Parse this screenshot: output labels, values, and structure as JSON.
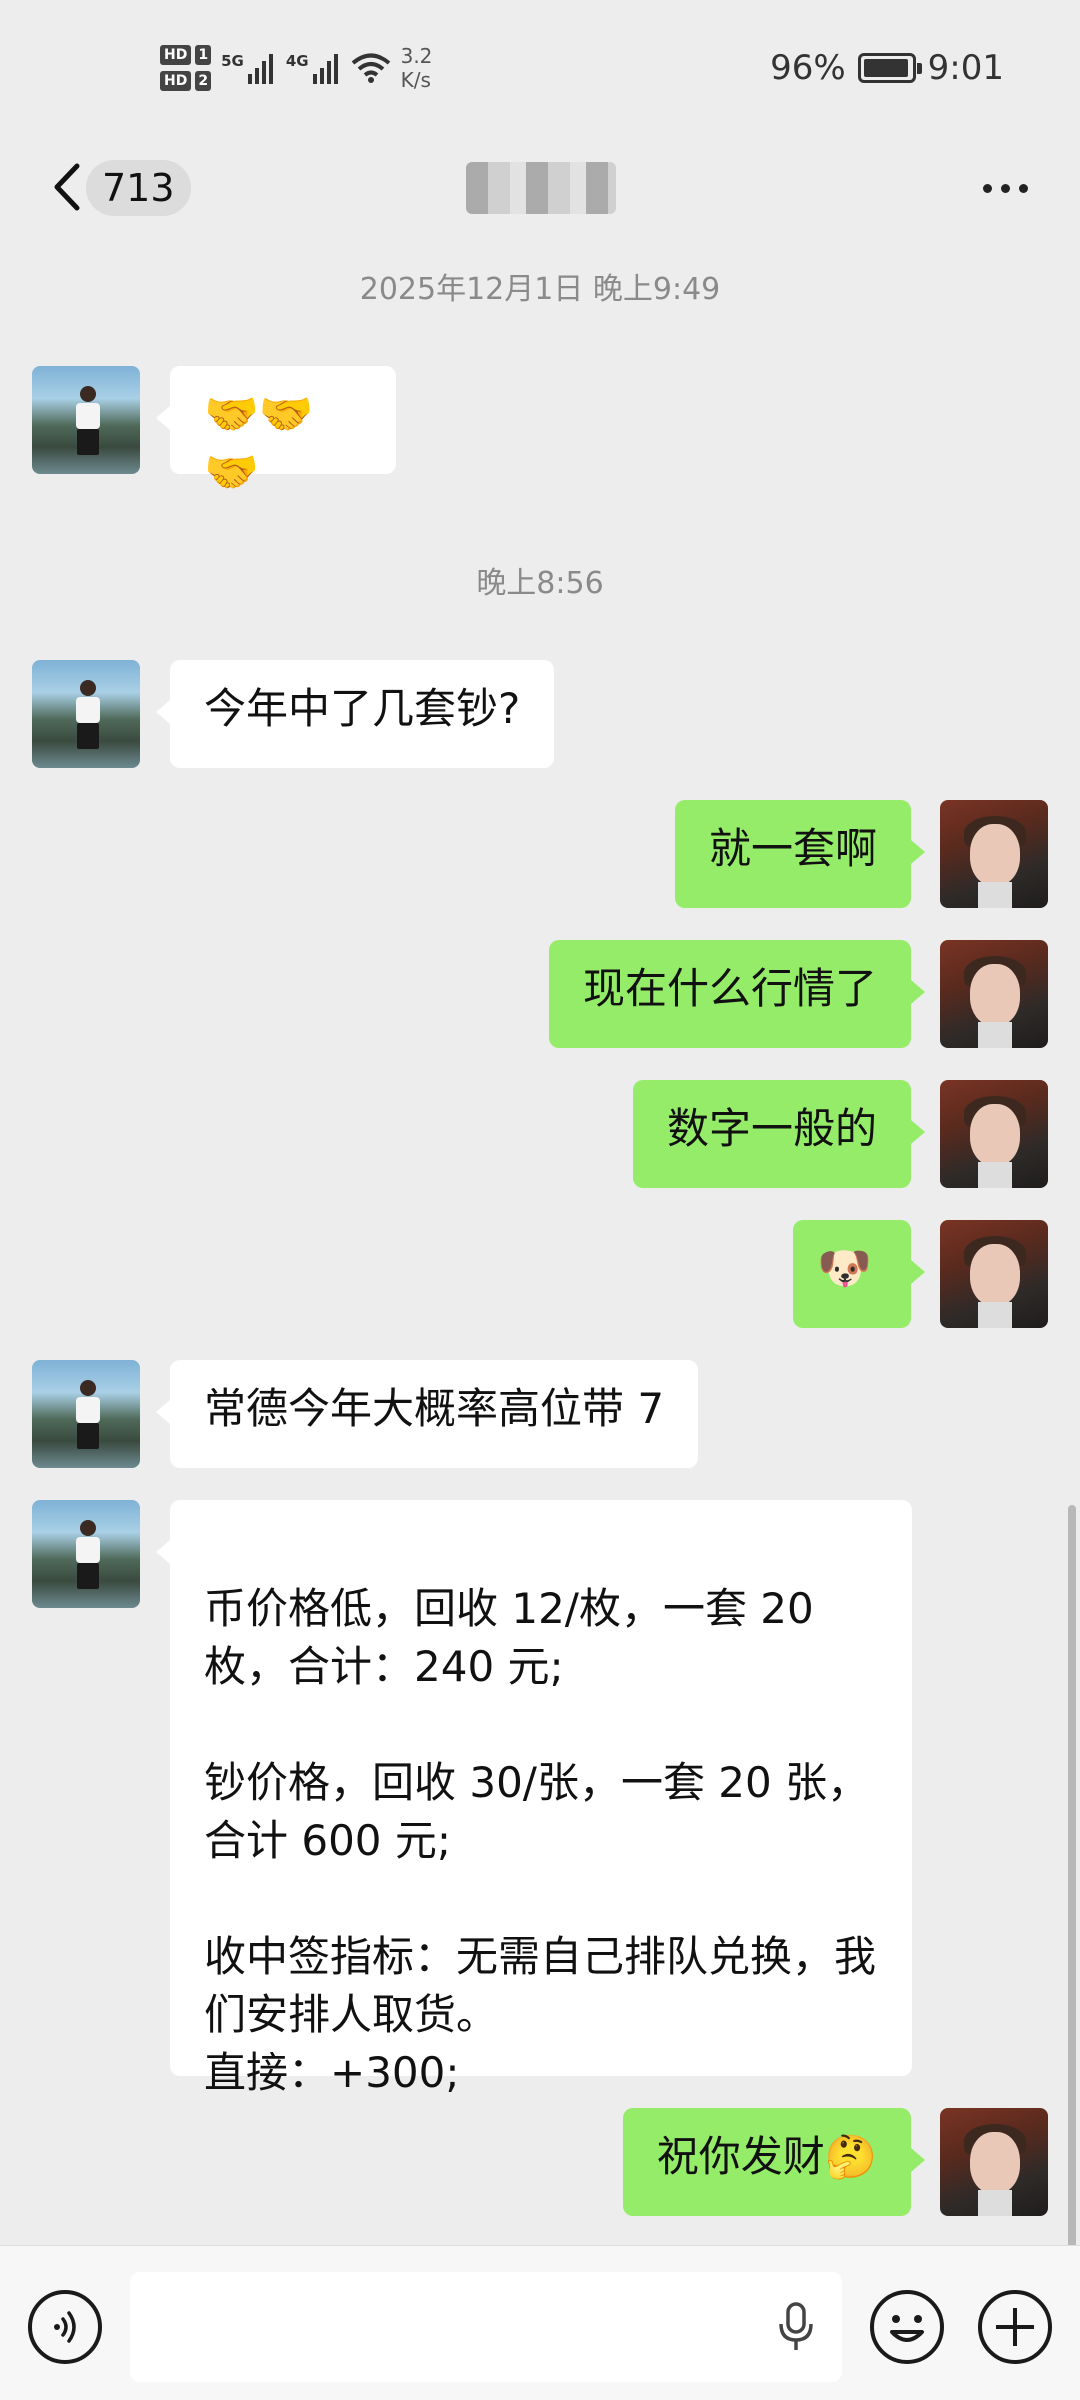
{
  "status_bar": {
    "hd1": "HD",
    "hd1_num": "1",
    "hd2": "HD",
    "hd2_num": "2",
    "sig1": "5G",
    "sig2": "4G",
    "speed_value": "3.2",
    "speed_unit": "K/s",
    "battery": "96%",
    "battery_level": 0.96,
    "time": "9:01"
  },
  "nav": {
    "unread_count": "713",
    "title_blurred": true,
    "back_icon": "chevron-left-icon",
    "more_icon": "more-dots-icon"
  },
  "chat": {
    "timestamps": [
      "2025年12月1日 晚上9:49",
      "晚上8:56"
    ],
    "messages": [
      {
        "side": "in",
        "text": "🤝🤝🤝"
      },
      {
        "side": "in",
        "text": "今年中了几套钞?"
      },
      {
        "side": "out",
        "text": "就一套啊"
      },
      {
        "side": "out",
        "text": "现在什么行情了"
      },
      {
        "side": "out",
        "text": "数字一般的"
      },
      {
        "side": "out",
        "text": "🐶"
      },
      {
        "side": "in",
        "text": "常德今年大概率高位带 7"
      },
      {
        "side": "in",
        "text": "币价格低，回收 12/枚，一套 20 枚，合计：240 元;\n\n钞价格，回收 30/张，一套 20 张，合计 600 元;\n\n收中签指标：无需自己排队兑换，我们安排人取货。\n直接：+300;"
      },
      {
        "side": "out",
        "text": "祝你发财🤔"
      }
    ]
  },
  "input_bar": {
    "voice_icon": "voice-icon",
    "mic_icon": "microphone-icon",
    "emoji_icon": "emoji-icon",
    "plus_icon": "plus-icon"
  },
  "colors": {
    "background": "#ededed",
    "outgoing_bubble": "#95ec69",
    "incoming_bubble": "#ffffff"
  }
}
